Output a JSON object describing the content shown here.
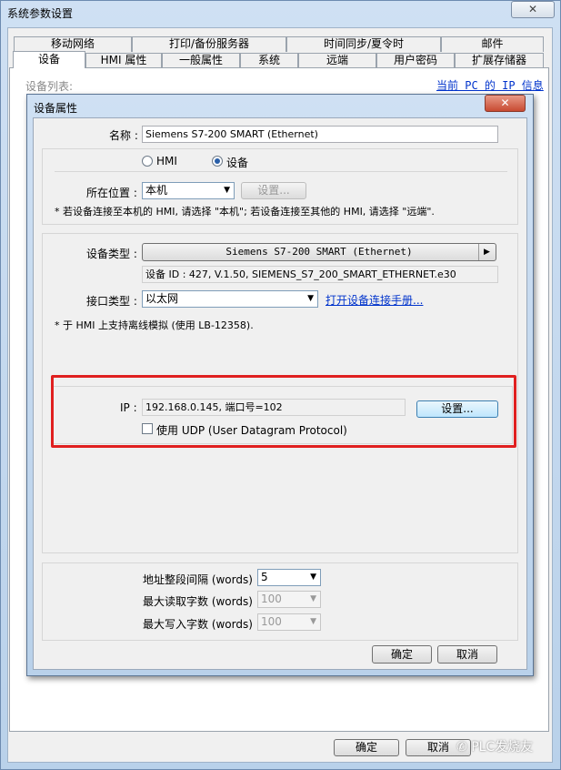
{
  "outer_window": {
    "title": "系统参数设置",
    "close_glyph": "✕",
    "tabs_row1": [
      "移动网络",
      "打印/备份服务器",
      "时间同步/夏令时",
      "邮件"
    ],
    "tabs_row2": [
      "设备",
      "HMI 属性",
      "一般属性",
      "系统",
      "远端",
      "用户密码",
      "扩展存储器"
    ],
    "device_list_label": "设备列表:",
    "pc_ip_link": "当前 PC 的 IP 信息",
    "ok_label": "确定",
    "cancel_label": "取消"
  },
  "dialog": {
    "title": "设备属性",
    "close_glyph": "✕",
    "name_label": "名称 :",
    "name_value": "Siemens S7-200 SMART (Ethernet)",
    "radio_hmi": "HMI",
    "radio_device": "设备",
    "location_label": "所在位置 :",
    "location_value": "本机",
    "location_settings_label": "设置...",
    "location_note": "* 若设备连接至本机的 HMI, 请选择 \"本机\"; 若设备连接至其他的 HMI, 请选择 \"远端\".",
    "device_type_label": "设备类型 :",
    "device_type_value": "Siemens S7-200 SMART (Ethernet)",
    "device_id_text": "设备 ID : 427, V.1.50, SIEMENS_S7_200_SMART_ETHERNET.e30",
    "interface_label": "接口类型 :",
    "interface_value": "以太网",
    "open_manual_link": "打开设备连接手册...",
    "offline_note": "* 于 HMI 上支持离线模拟 (使用 LB-12358).",
    "ip_label": "IP :",
    "ip_value": "192.168.0.145, 端口号=102",
    "ip_settings_label": "设置...",
    "udp_label": "使用 UDP (User Datagram Protocol)",
    "addr_interval_label": "地址整段间隔 (words) :",
    "addr_interval_value": "5",
    "max_read_label": "最大读取字数 (words) :",
    "max_read_value": "100",
    "max_write_label": "最大写入字数 (words) :",
    "max_write_value": "100",
    "ok_label": "确定",
    "cancel_label": "取消"
  },
  "watermark": "PLC发烧友",
  "colors": {
    "highlight": "#e02020",
    "link": "#0033cc",
    "title_gradient_top": "#cfe0f3"
  }
}
